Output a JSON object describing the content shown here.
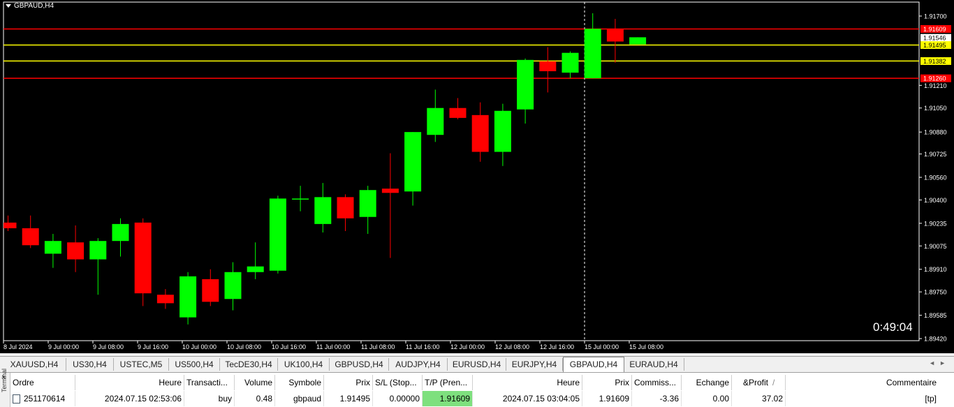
{
  "chart": {
    "title": "GBPAUD,H4",
    "countdown": "0:49:04",
    "colors": {
      "background": "#000000",
      "bull": "#00ff00",
      "bear": "#ff0000",
      "axis": "#ffffff",
      "tp_sl_line": "#ff0000",
      "entry_line": "#ffff00"
    },
    "y_ticks": [
      "1.91700",
      "1.91210",
      "1.91050",
      "1.90880",
      "1.90725",
      "1.90560",
      "1.90400",
      "1.90235",
      "1.90075",
      "1.89910",
      "1.89750",
      "1.89585",
      "1.89420"
    ],
    "x_ticks": [
      "8 Jul 2024",
      "9 Jul 00:00",
      "9 Jul 08:00",
      "9 Jul 16:00",
      "10 Jul 00:00",
      "10 Jul 08:00",
      "10 Jul 16:00",
      "11 Jul 00:00",
      "11 Jul 08:00",
      "11 Jul 16:00",
      "12 Jul 00:00",
      "12 Jul 08:00",
      "12 Jul 16:00",
      "15 Jul 00:00",
      "15 Jul 08:00"
    ],
    "price_labels": [
      {
        "value": "1.91609",
        "color": "#ff0000",
        "text_color": "#ffffff"
      },
      {
        "value": "1.91546",
        "color": "#ffffff",
        "text_color": "#000000"
      },
      {
        "value": "1.91495",
        "color": "#ffff00",
        "text_color": "#000000"
      },
      {
        "value": "1.91382",
        "color": "#ffff00",
        "text_color": "#000000"
      },
      {
        "value": "1.91260",
        "color": "#ff0000",
        "text_color": "#ffffff"
      }
    ]
  },
  "chart_data": {
    "type": "candlestick",
    "title": "GBPAUD,H4",
    "ylim": [
      1.8942,
      1.9175
    ],
    "horizontal_lines": [
      {
        "price": 1.91609,
        "color": "#ff0000"
      },
      {
        "price": 1.91495,
        "color": "#ffff00"
      },
      {
        "price": 1.91382,
        "color": "#ffff00"
      },
      {
        "price": 1.9126,
        "color": "#ff0000"
      }
    ],
    "candles": [
      {
        "o": 1.9024,
        "h": 1.9029,
        "l": 1.9018,
        "c": 1.902
      },
      {
        "o": 1.902,
        "h": 1.9029,
        "l": 1.9006,
        "c": 1.9008
      },
      {
        "o": 1.9002,
        "h": 1.9016,
        "l": 1.8992,
        "c": 1.9011
      },
      {
        "o": 1.901,
        "h": 1.9022,
        "l": 1.8989,
        "c": 1.8998
      },
      {
        "o": 1.8998,
        "h": 1.9013,
        "l": 1.8973,
        "c": 1.9011
      },
      {
        "o": 1.9011,
        "h": 1.9027,
        "l": 1.9,
        "c": 1.9023
      },
      {
        "o": 1.9024,
        "h": 1.9027,
        "l": 1.8965,
        "c": 1.8974
      },
      {
        "o": 1.8973,
        "h": 1.8977,
        "l": 1.8963,
        "c": 1.8967
      },
      {
        "o": 1.8957,
        "h": 1.8989,
        "l": 1.8952,
        "c": 1.8986
      },
      {
        "o": 1.8984,
        "h": 1.8991,
        "l": 1.8965,
        "c": 1.8968
      },
      {
        "o": 1.897,
        "h": 1.8996,
        "l": 1.8962,
        "c": 1.8989
      },
      {
        "o": 1.8989,
        "h": 1.901,
        "l": 1.8984,
        "c": 1.8993
      },
      {
        "o": 1.899,
        "h": 1.9043,
        "l": 1.8988,
        "c": 1.9041
      },
      {
        "o": 1.9041,
        "h": 1.905,
        "l": 1.9032,
        "c": 1.9041
      },
      {
        "o": 1.9023,
        "h": 1.9052,
        "l": 1.9017,
        "c": 1.9042
      },
      {
        "o": 1.9042,
        "h": 1.9044,
        "l": 1.9018,
        "c": 1.9027
      },
      {
        "o": 1.9028,
        "h": 1.905,
        "l": 1.9016,
        "c": 1.9047
      },
      {
        "o": 1.9048,
        "h": 1.9073,
        "l": 1.8999,
        "c": 1.9045
      },
      {
        "o": 1.9046,
        "h": 1.9088,
        "l": 1.9036,
        "c": 1.9088
      },
      {
        "o": 1.9086,
        "h": 1.9118,
        "l": 1.9081,
        "c": 1.9105
      },
      {
        "o": 1.9105,
        "h": 1.9112,
        "l": 1.9097,
        "c": 1.9098
      },
      {
        "o": 1.91,
        "h": 1.9109,
        "l": 1.9067,
        "c": 1.9074
      },
      {
        "o": 1.9074,
        "h": 1.9108,
        "l": 1.9064,
        "c": 1.9103
      },
      {
        "o": 1.9104,
        "h": 1.914,
        "l": 1.9094,
        "c": 1.9139
      },
      {
        "o": 1.9138,
        "h": 1.9148,
        "l": 1.9116,
        "c": 1.9131
      },
      {
        "o": 1.913,
        "h": 1.9145,
        "l": 1.9126,
        "c": 1.9144
      },
      {
        "o": 1.9126,
        "h": 1.9172,
        "l": 1.9126,
        "c": 1.9161
      },
      {
        "o": 1.9161,
        "h": 1.9168,
        "l": 1.9137,
        "c": 1.9152
      },
      {
        "o": 1.915,
        "h": 1.9155,
        "l": 1.915,
        "c": 1.9155
      }
    ]
  },
  "tabs": [
    "XAUUSD,H4",
    "US30,H4",
    "USTEC,M5",
    "US500,H4",
    "TecDE30,H4",
    "UK100,H4",
    "GBPUSD,H4",
    "AUDJPY,H4",
    "EURUSD,H4",
    "EURJPY,H4",
    "GBPAUD,H4",
    "EURAUD,H4"
  ],
  "active_tab": "GBPAUD,H4",
  "terminal": {
    "side_label": "Terminal",
    "headers": [
      "Ordre",
      "Heure",
      "Transacti...",
      "Volume",
      "Symbole",
      "Prix",
      "S/L (Stop...",
      "T/P (Pren...",
      "Heure",
      "Prix",
      "Commiss...",
      "Echange",
      "&Profit",
      "/",
      "Commentaire"
    ],
    "row": {
      "order": "251170614",
      "time_open": "2024.07.15 02:53:06",
      "type": "buy",
      "volume": "0.48",
      "symbol": "gbpaud",
      "price_open": "1.91495",
      "sl": "0.00000",
      "tp": "1.91609",
      "time_close": "2024.07.15 03:04:05",
      "price_close": "1.91609",
      "commission": "-3.36",
      "swap": "0.00",
      "profit": "37.02",
      "comment": "[tp]"
    }
  }
}
